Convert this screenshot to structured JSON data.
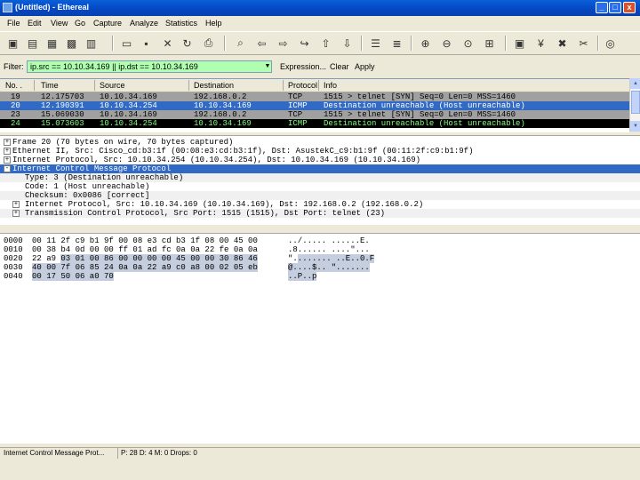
{
  "window": {
    "title": "(Untitled) - Ethereal",
    "buttons": [
      "_",
      "□",
      "x"
    ]
  },
  "menu": [
    "File",
    "Edit",
    "View",
    "Go",
    "Capture",
    "Analyze",
    "Statistics",
    "Help"
  ],
  "toolbar": [
    "interface-list-icon",
    "capture-options-icon",
    "start-capture-icon",
    "restart-capture-icon",
    "open-file-icon",
    "save-file-icon",
    "close-file-icon",
    "reload-icon",
    "print-icon",
    "find-packet-icon",
    "go-back-icon",
    "go-forward-icon",
    "go-to-packet-icon",
    "go-first-icon",
    "go-last-icon",
    "colorize-icon",
    "auto-scroll-icon",
    "zoom-in-icon",
    "zoom-out-icon",
    "zoom-normal-icon",
    "resize-columns-icon",
    "capture-filters-icon",
    "display-filters-icon",
    "coloring-rules-icon",
    "preferences-icon",
    "help-icon"
  ],
  "filter": {
    "label": "Filter:",
    "value": "ip.src == 10.10.34.169 || ip.dst == 10.10.34.169",
    "expression": "Expression...",
    "clear": "Clear",
    "apply": "Apply",
    "color": "#afffaf"
  },
  "packet_list": {
    "columns": [
      "No. .",
      "Time",
      "Source",
      "Destination",
      "Protocol",
      "Info"
    ],
    "rows": [
      {
        "no": "19",
        "time": "12.175703",
        "src": "10.10.34.169",
        "dst": "192.168.0.2",
        "proto": "TCP",
        "info": "1515 > telnet [SYN] Seq=0 Len=0 MSS=1460",
        "bg": "#a0a0a0",
        "fg": "#000000"
      },
      {
        "no": "20",
        "time": "12.190391",
        "src": "10.10.34.254",
        "dst": "10.10.34.169",
        "proto": "ICMP",
        "info": "Destination unreachable (Host unreachable)",
        "bg": "#316ac5",
        "fg": "#ffffff"
      },
      {
        "no": "23",
        "time": "15.069030",
        "src": "10.10.34.169",
        "dst": "192.168.0.2",
        "proto": "TCP",
        "info": "1515 > telnet [SYN] Seq=0 Len=0 MSS=1460",
        "bg": "#a0a0a0",
        "fg": "#000000"
      },
      {
        "no": "24",
        "time": "15.073603",
        "src": "10.10.34.254",
        "dst": "10.10.34.169",
        "proto": "ICMP",
        "info": "Destination unreachable (Host unreachable)",
        "bg": "#000000",
        "fg": "#7fff7f"
      }
    ]
  },
  "details": [
    {
      "expander": "+",
      "indent": 0,
      "text": "Frame 20 (70 bytes on wire, 70 bytes captured)",
      "selected": false
    },
    {
      "expander": "+",
      "indent": 0,
      "text": "Ethernet II, Src: Cisco_cd:b3:1f (00:08:e3:cd:b3:1f), Dst: AsustekC_c9:b1:9f (00:11:2f:c9:b1:9f)",
      "selected": false
    },
    {
      "expander": "+",
      "indent": 0,
      "text": "Internet Protocol, Src: 10.10.34.254 (10.10.34.254), Dst: 10.10.34.169 (10.10.34.169)",
      "selected": false
    },
    {
      "expander": "-",
      "indent": 0,
      "text": "Internet Control Message Protocol",
      "selected": true
    },
    {
      "expander": "",
      "indent": 1,
      "text": "Type: 3 (Destination unreachable)",
      "selected": false
    },
    {
      "expander": "",
      "indent": 1,
      "text": "Code: 1 (Host unreachable)",
      "selected": false
    },
    {
      "expander": "",
      "indent": 1,
      "text": "Checksum: 0x0086 [correct]",
      "selected": false
    },
    {
      "expander": "+",
      "indent": 1,
      "text": "Internet Protocol, Src: 10.10.34.169 (10.10.34.169), Dst: 192.168.0.2 (192.168.0.2)",
      "selected": false
    },
    {
      "expander": "+",
      "indent": 1,
      "text": "Transmission Control Protocol, Src Port: 1515 (1515), Dst Port: telnet (23)",
      "selected": false
    }
  ],
  "hex": [
    {
      "offset": "0000",
      "plain": "00 11 2f c9 b1 9f 00 08  e3 cd b3 1f 08 00 45 00",
      "hl": "",
      "ascii_plain": "../..... ......E.",
      "ascii_hl": ""
    },
    {
      "offset": "0010",
      "plain": "00 38 b4 0d 00 00 ff 01  ad fc 0a 0a 22 fe 0a 0a",
      "hl": "",
      "ascii_plain": ".8...... ....\"...",
      "ascii_hl": ""
    },
    {
      "offset": "0020",
      "plain": "22 a9 ",
      "hl": "03 01 00 86 00 00  00 00 45 00 00 30 86 46",
      "ascii_plain": "\".",
      "ascii_hl": "....... ..E..0.F"
    },
    {
      "offset": "0030",
      "plain": "",
      "hl": "40 00 7f 06 85 24 0a 0a  22 a9 c0 a8 00 02 05 eb",
      "ascii_plain": "",
      "ascii_hl": "@....$.. \"......."
    },
    {
      "offset": "0040",
      "plain": "",
      "hl": "00 17 50 06 a0 70",
      "ascii_plain": "",
      "ascii_hl": "..P..p"
    }
  ],
  "status": {
    "field": "Internet Control Message Prot...",
    "counts": "P: 28 D: 4 M: 0 Drops: 0"
  }
}
